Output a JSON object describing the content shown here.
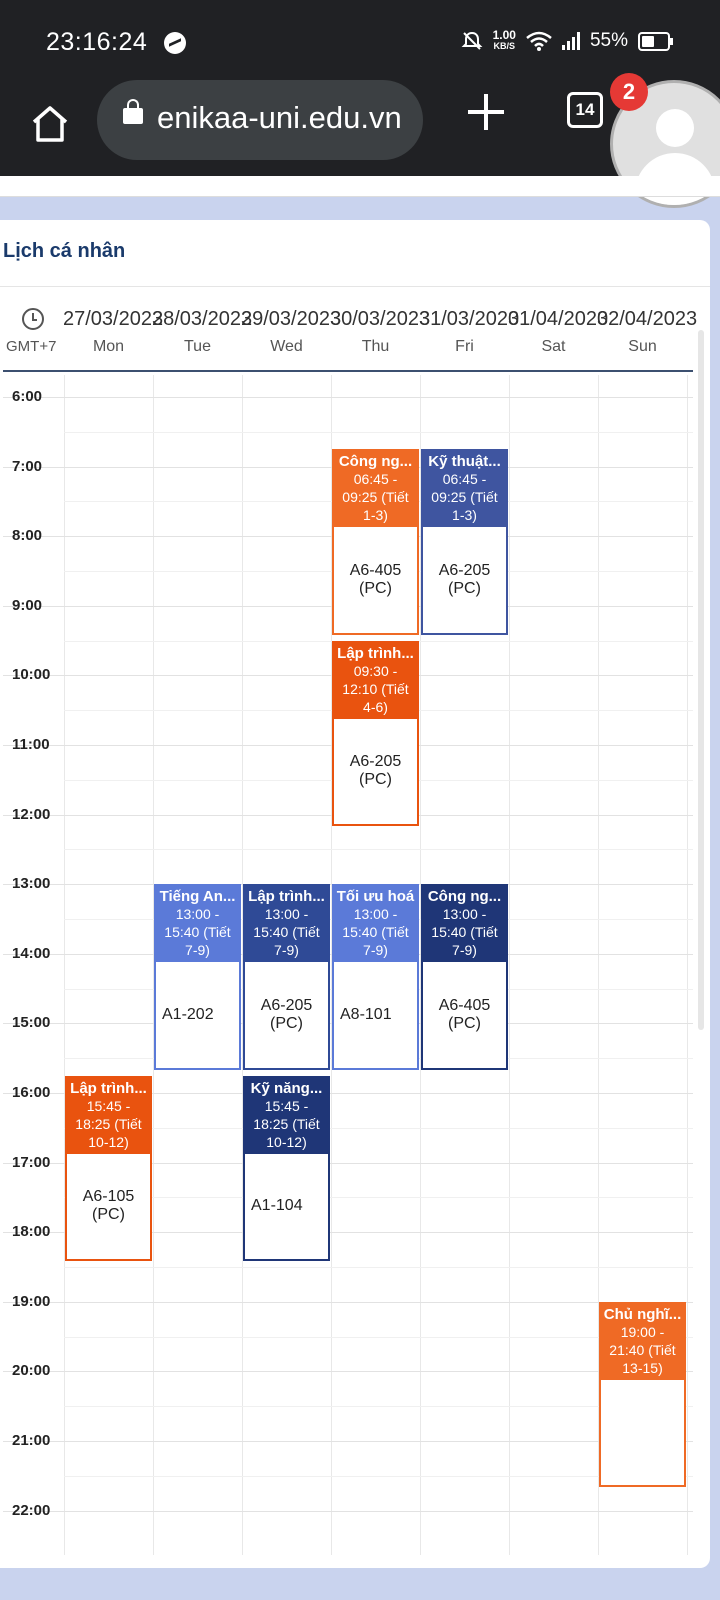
{
  "status": {
    "time": "23:16:24",
    "speed": "1.00",
    "speed_unit": "KB/S",
    "battery": "55%"
  },
  "browser": {
    "url": "enikaa-uni.edu.vn",
    "tab_count": "14",
    "notification_count": "2"
  },
  "calendar": {
    "title": "Lịch cá nhân",
    "timezone": "GMT+7",
    "days": [
      {
        "date": "27/03/2023",
        "day": "Mon"
      },
      {
        "date": "28/03/2023",
        "day": "Tue"
      },
      {
        "date": "29/03/2023",
        "day": "Wed"
      },
      {
        "date": "30/03/2023",
        "day": "Thu"
      },
      {
        "date": "31/03/2023",
        "day": "Fri"
      },
      {
        "date": "01/04/2023",
        "day": "Sat"
      },
      {
        "date": "02/04/2023",
        "day": "Sun"
      }
    ],
    "hours": [
      "6:00",
      "7:00",
      "8:00",
      "9:00",
      "10:00",
      "11:00",
      "12:00",
      "13:00",
      "14:00",
      "15:00",
      "16:00",
      "17:00",
      "18:00",
      "19:00",
      "20:00",
      "21:00",
      "22:00"
    ],
    "events": [
      {
        "day": 3,
        "start": 6.75,
        "end": 9.4167,
        "title": "Công ng...",
        "time": "06:45 - 09:25 (Tiết 1-3)",
        "room": "A6-405 (PC)",
        "color": "#ef6a25"
      },
      {
        "day": 4,
        "start": 6.75,
        "end": 9.4167,
        "title": "Kỹ thuật...",
        "time": "06:45 - 09:25 (Tiết 1-3)",
        "room": "A6-205 (PC)",
        "color": "#3f55a0"
      },
      {
        "day": 3,
        "start": 9.5,
        "end": 12.1667,
        "title": "Lập trình...",
        "time": "09:30 - 12:10 (Tiết 4-6)",
        "room": "A6-205 (PC)",
        "color": "#e9530f"
      },
      {
        "day": 1,
        "start": 13.0,
        "end": 15.6667,
        "title": "Tiếng An...",
        "time": "13:00 - 15:40 (Tiết 7-9)",
        "room": "A1-202",
        "color": "#5b7ad8"
      },
      {
        "day": 2,
        "start": 13.0,
        "end": 15.6667,
        "title": "Lập trình...",
        "time": "13:00 - 15:40 (Tiết 7-9)",
        "room": "A6-205 (PC)",
        "color": "#2f4a96"
      },
      {
        "day": 3,
        "start": 13.0,
        "end": 15.6667,
        "title": "Tối ưu hoá",
        "time": "13:00 - 15:40 (Tiết 7-9)",
        "room": "A8-101",
        "color": "#5b7ad8"
      },
      {
        "day": 4,
        "start": 13.0,
        "end": 15.6667,
        "title": "Công ng...",
        "time": "13:00 - 15:40 (Tiết 7-9)",
        "room": "A6-405 (PC)",
        "color": "#1f3677"
      },
      {
        "day": 0,
        "start": 15.75,
        "end": 18.4167,
        "title": "Lập trình...",
        "time": "15:45 - 18:25 (Tiết 10-12)",
        "room": "A6-105 (PC)",
        "color": "#e9530f"
      },
      {
        "day": 2,
        "start": 15.75,
        "end": 18.4167,
        "title": "Kỹ năng...",
        "time": "15:45 - 18:25 (Tiết 10-12)",
        "room": "A1-104",
        "color": "#1f3677"
      },
      {
        "day": 6,
        "start": 19.0,
        "end": 21.6667,
        "title": "Chủ nghĩ...",
        "time": "19:00 - 21:40 (Tiết 13-15)",
        "room": "",
        "color": "#ef6a25"
      }
    ]
  }
}
